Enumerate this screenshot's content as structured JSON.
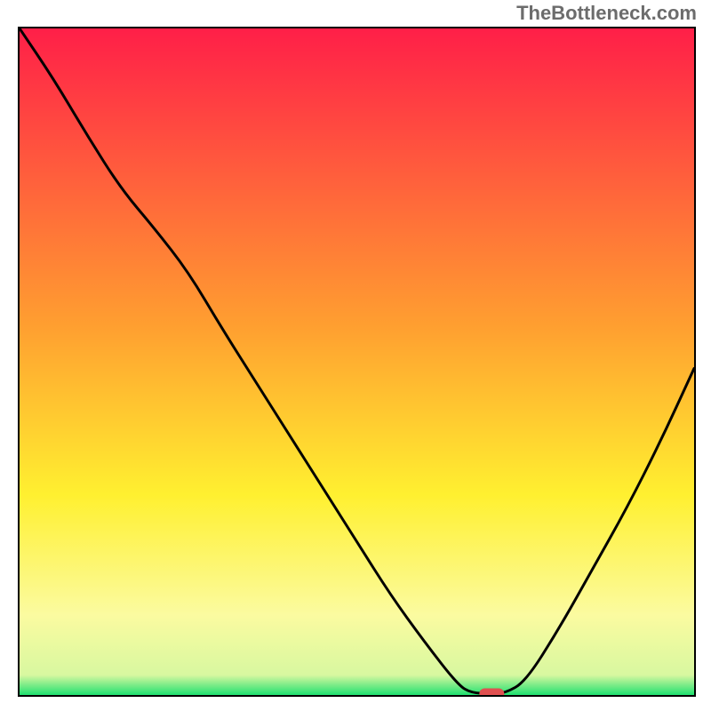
{
  "watermark": "TheBottleneck.com",
  "colors": {
    "red_top": "#ff1f48",
    "orange": "#ffa030",
    "yellow": "#fff030",
    "pale_yellow": "#fbfba0",
    "green": "#20e070",
    "curve": "#000000",
    "marker": "#e05050"
  },
  "chart_data": {
    "type": "line",
    "title": "",
    "xlabel": "",
    "ylabel": "",
    "xlim": [
      0,
      100
    ],
    "ylim": [
      0,
      100
    ],
    "x": [
      0,
      5,
      10,
      15,
      20,
      25,
      30,
      35,
      40,
      45,
      50,
      55,
      60,
      65,
      67,
      70,
      72,
      75,
      80,
      85,
      90,
      95,
      100
    ],
    "values": [
      101,
      92.5,
      84,
      76,
      70,
      63.5,
      55,
      47,
      39,
      31,
      23,
      15,
      8,
      1.5,
      0.3,
      0.2,
      0.3,
      2,
      10,
      19,
      28,
      38,
      49
    ],
    "marker": {
      "x": 70,
      "y": 0.2
    },
    "background_gradient_stops": [
      {
        "pos": 0.0,
        "color": "#ff1f48"
      },
      {
        "pos": 0.45,
        "color": "#ffa030"
      },
      {
        "pos": 0.7,
        "color": "#fff030"
      },
      {
        "pos": 0.88,
        "color": "#fbfba0"
      },
      {
        "pos": 0.97,
        "color": "#d8f8a0"
      },
      {
        "pos": 1.0,
        "color": "#20e070"
      }
    ]
  }
}
